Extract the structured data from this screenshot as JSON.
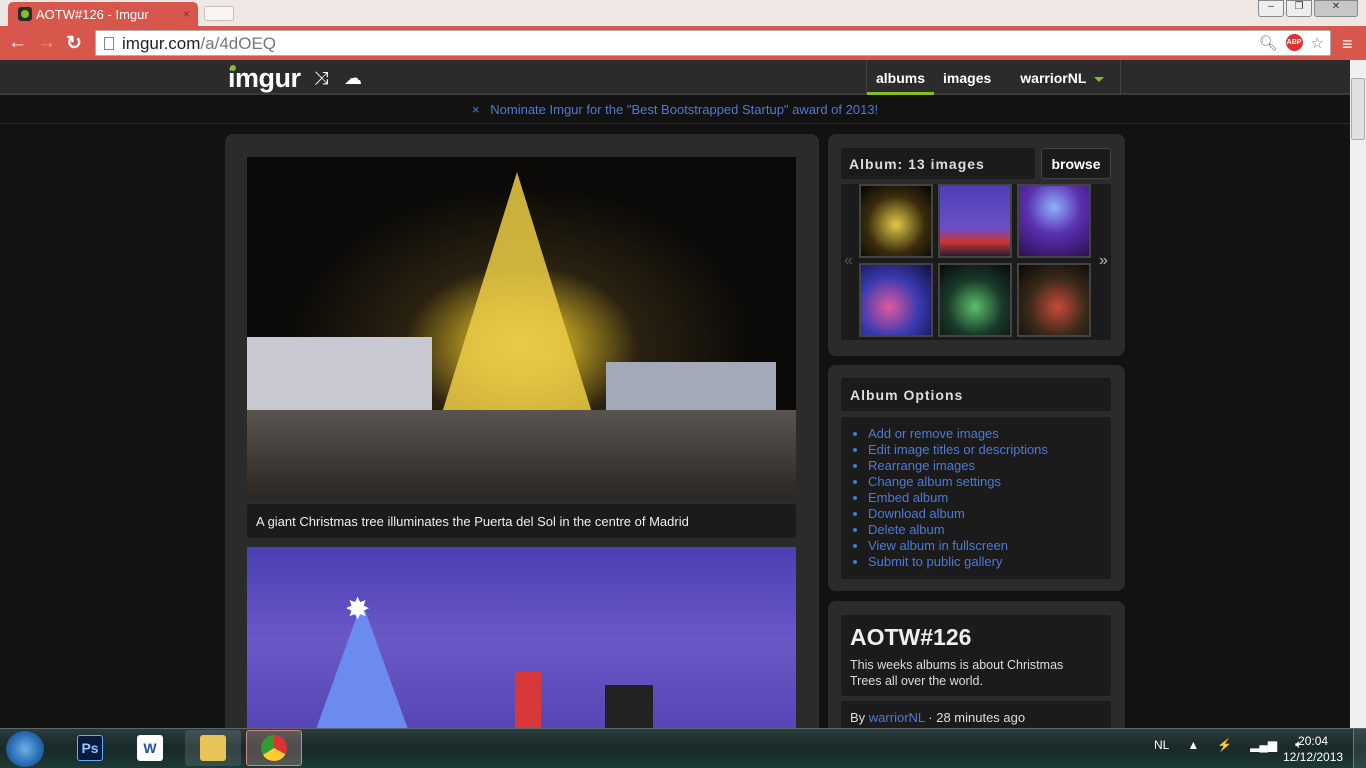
{
  "browser": {
    "tab_title": "AOTW#126 - Imgur",
    "tab_close": "×",
    "url_host": "imgur.com",
    "url_path": "/a/4dOEQ",
    "abp_label": "ABP",
    "window_buttons": [
      "–",
      "❐",
      "✕"
    ]
  },
  "site": {
    "logo": "imgur",
    "nav": [
      {
        "label": "albums",
        "active": true
      },
      {
        "label": "images",
        "active": false
      }
    ],
    "username": "warriorNL",
    "notice_close": "×",
    "notice_text": "Nominate Imgur for the \"Best Bootstrapped Startup\" award of 2013!",
    "accent": "#85bf25",
    "link_color": "#4f79d5"
  },
  "main": {
    "images": [
      {
        "caption": "A giant Christmas tree illuminates the Puerta del Sol in the centre of Madrid"
      },
      {
        "caption": ""
      }
    ]
  },
  "album": {
    "title": "Album: 13 images",
    "browse_label": "browse",
    "prev": "«",
    "next": "»",
    "thumb_count_visible": 6
  },
  "options": {
    "title": "Album Options",
    "items": [
      "Add or remove images",
      "Edit image titles or descriptions",
      "Rearrange images",
      "Change album settings",
      "Embed album",
      "Download album",
      "Delete album",
      "View album in fullscreen",
      "Submit to public gallery"
    ]
  },
  "description": {
    "name": "AOTW#126",
    "text": "This weeks albums is about Christmas Trees all over the world.",
    "by_prefix": "By ",
    "author": "warriorNL",
    "time": " · 28 minutes ago"
  },
  "taskbar": {
    "apps": [
      "Ps",
      "W",
      "",
      ""
    ],
    "language": "NL",
    "time": "20:04",
    "date": "12/12/2013"
  }
}
